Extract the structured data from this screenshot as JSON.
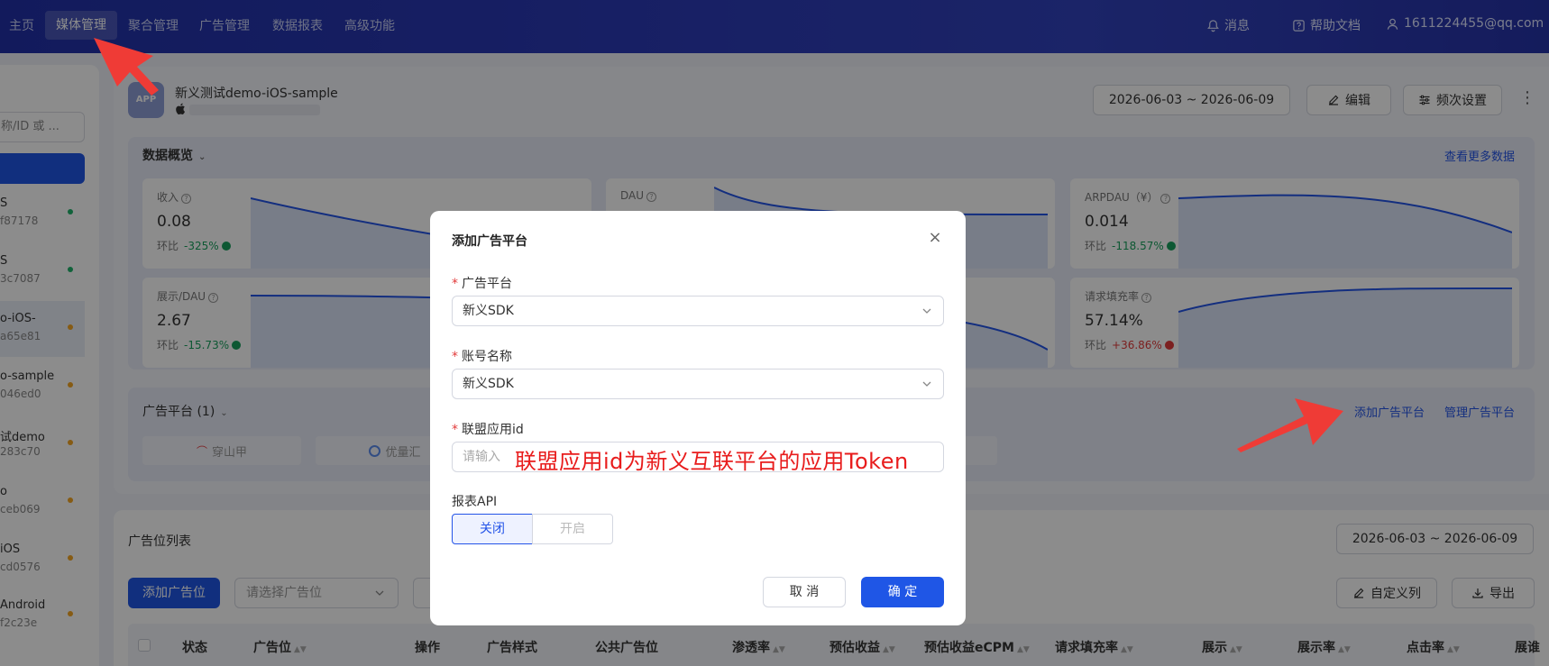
{
  "topnav": {
    "items": [
      "主页",
      "媒体管理",
      "聚合管理",
      "广告管理",
      "数据报表",
      "高级功能"
    ],
    "messages": "消息",
    "help": "帮助文档",
    "account": "1611224455@qq.com"
  },
  "sidebar": {
    "search_placeholder": "称/ID 或 ...",
    "apps": [
      {
        "name": "S",
        "id": "f87178",
        "status_color": "#1fb26b"
      },
      {
        "name": "S",
        "id": "3c7087",
        "status_color": "#1fb26b"
      },
      {
        "name": "o-iOS-",
        "id": "a65e81",
        "status_color": "#f5a623"
      },
      {
        "name": "o-sample",
        "id": "046ed0",
        "status_color": "#f5a623"
      },
      {
        "name": "试demo",
        "id": "283c70",
        "status_color": "#f5a623"
      },
      {
        "name": "o",
        "id": "ceb069",
        "status_color": "#f5a623"
      },
      {
        "name": "iOS",
        "id": "cd0576",
        "status_color": "#f5a623"
      },
      {
        "name": "Android",
        "id": "f2c23e",
        "status_color": "#f5a623"
      }
    ]
  },
  "app_header": {
    "icon_text": "APP",
    "title": "新义测试demo-iOS-sample",
    "date_range": "2026-06-03 ~ 2026-06-09",
    "edit_label": "编辑",
    "freq_label": "频次设置",
    "more": "⋮"
  },
  "overview": {
    "title": "数据概览",
    "more_link": "查看更多数据",
    "metrics": [
      {
        "label": "收入",
        "value": "0.08",
        "change_prefix": "环比",
        "change": "-325%",
        "direction": "up"
      },
      {
        "label": "DAU",
        "value": "",
        "change_prefix": "",
        "change": "",
        "direction": ""
      },
      {
        "label": "ARPDAU（¥）",
        "value": "0.014",
        "change_prefix": "环比",
        "change": "-118.57%",
        "direction": "up"
      },
      {
        "label": "展示/DAU",
        "value": "2.67",
        "change_prefix": "环比",
        "change": "-15.73%",
        "direction": "up"
      },
      {
        "label": "",
        "value": "",
        "change_prefix": "",
        "change": "",
        "direction": ""
      },
      {
        "label": "请求填充率",
        "value": "57.14%",
        "change_prefix": "环比",
        "change": "+36.86%",
        "direction": "down"
      }
    ]
  },
  "platforms": {
    "title": "广告平台 (1)",
    "add_link": "添加广告平台",
    "manage_link": "管理广告平台",
    "chips": [
      "穿山甲",
      "优量汇"
    ]
  },
  "slots": {
    "title": "广告位列表",
    "date_range": "2026-06-03 ~ 2026-06-09",
    "add_label": "添加广告位",
    "select_placeholder": "请选择广告位",
    "custom_cols": "自定义列",
    "export": "导出",
    "columns": [
      "状态",
      "广告位",
      "操作",
      "广告样式",
      "公共广告位",
      "渗透率",
      "预估收益",
      "预估收益eCPM",
      "请求填充率",
      "展示",
      "展示率",
      "点击率",
      "展谁"
    ]
  },
  "modal": {
    "title": "添加广告平台",
    "close": "×",
    "platform_label": "广告平台",
    "platform_value": "新义SDK",
    "account_label": "账号名称",
    "account_value": "新义SDK",
    "appid_label": "联盟应用id",
    "appid_placeholder": "请输入",
    "annotation": "联盟应用id为新义互联平台的应用Token",
    "report_api_label": "报表API",
    "report_off": "关闭",
    "report_on": "开启",
    "cancel": "取 消",
    "confirm": "确 定"
  },
  "colors": {
    "primary": "#1f56e6",
    "nav_bg": "#2c3bb8",
    "annotation_red": "#e81c1c",
    "green": "#19a05d",
    "red": "#e23b3b"
  }
}
